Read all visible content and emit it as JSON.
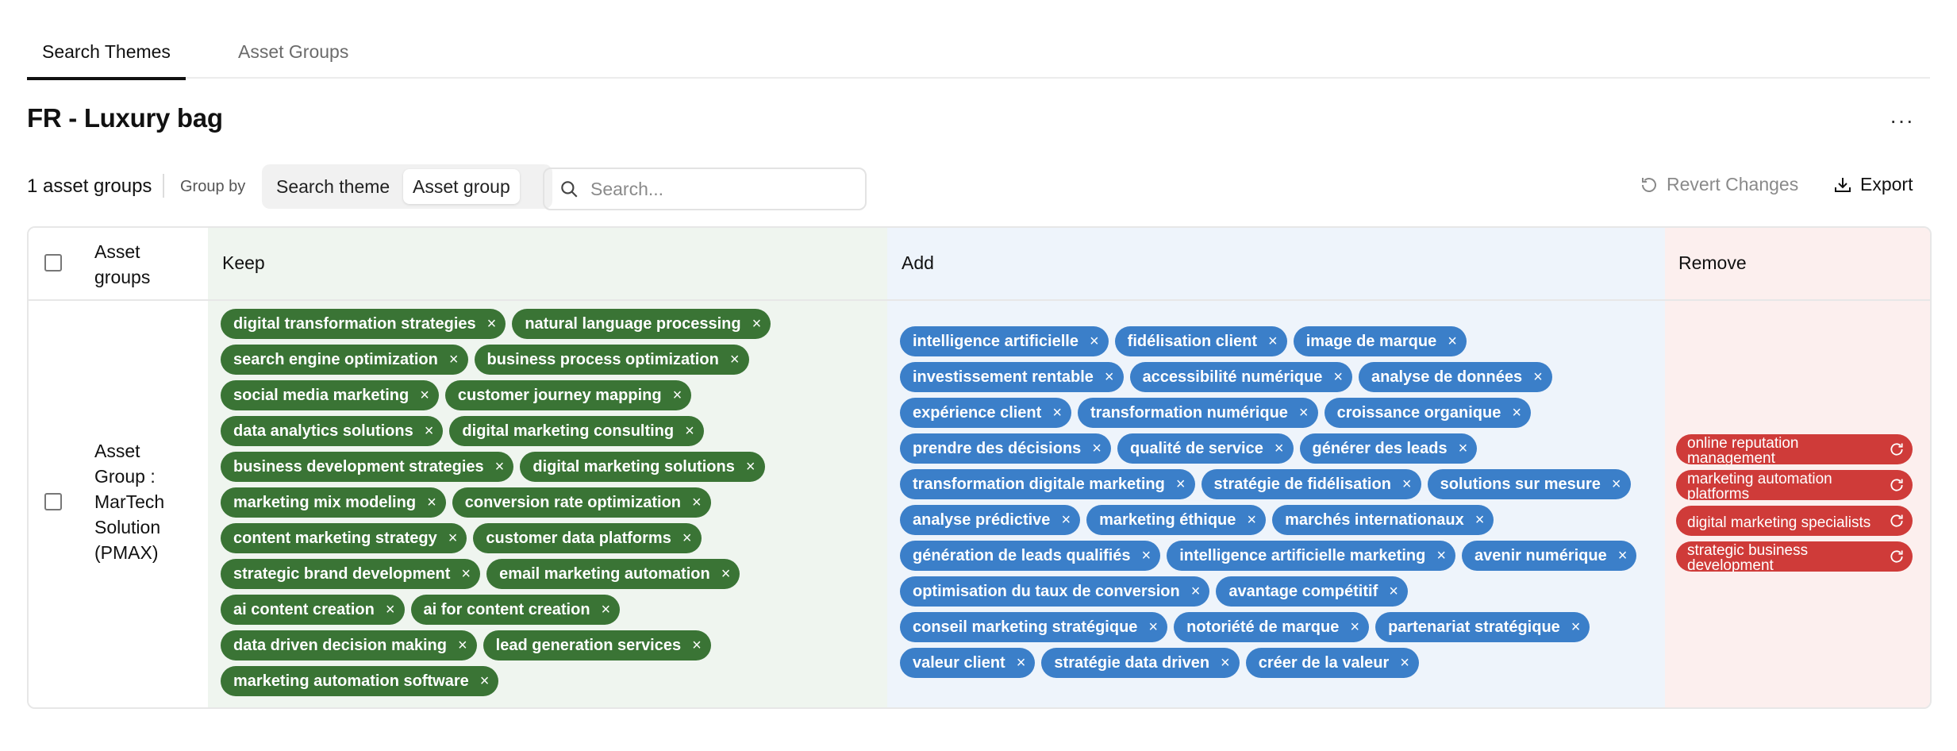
{
  "tabs": {
    "active": "Search Themes",
    "inactive": "Asset Groups"
  },
  "page": {
    "title": "FR - Luxury bag",
    "more": "···"
  },
  "toolbar": {
    "count": "1 asset groups",
    "group_by": "Group by",
    "segment": {
      "option1": "Search theme",
      "option2": "Asset group",
      "selected": "Asset group"
    },
    "search_placeholder": "Search...",
    "revert": "Revert Changes",
    "export": "Export"
  },
  "table": {
    "headers": {
      "asset_groups": "Asset groups",
      "keep": "Keep",
      "add": "Add",
      "remove": "Remove"
    },
    "row": {
      "asset_group": "Asset Group : MarTech Solution (PMAX)",
      "keep": [
        "digital transformation strategies",
        "natural language processing",
        "search engine optimization",
        "business process optimization",
        "social media marketing",
        "customer journey mapping",
        "data analytics solutions",
        "digital marketing consulting",
        "business development strategies",
        "digital marketing solutions",
        "marketing mix modeling",
        "conversion rate optimization",
        "content marketing strategy",
        "customer data platforms",
        "strategic brand development",
        "email marketing automation",
        "ai content creation",
        "ai for content creation",
        "data driven decision making",
        "lead generation services",
        "marketing automation software"
      ],
      "add": [
        "intelligence artificielle",
        "fidélisation client",
        "image de marque",
        "investissement rentable",
        "accessibilité numérique",
        "analyse de données",
        "expérience client",
        "transformation numérique",
        "croissance organique",
        "prendre des décisions",
        "qualité de service",
        "générer des leads",
        "transformation digitale marketing",
        "stratégie de fidélisation",
        "solutions sur mesure",
        "analyse prédictive",
        "marketing éthique",
        "marchés internationaux",
        "génération de leads qualifiés",
        "intelligence artificielle marketing",
        "avenir numérique",
        "optimisation du taux de conversion",
        "avantage compétitif",
        "conseil marketing stratégique",
        "notoriété de marque",
        "partenariat stratégique",
        "valeur client",
        "stratégie data driven",
        "créer de la valeur"
      ],
      "remove": [
        "online reputation management",
        "marketing automation platforms",
        "digital marketing specialists",
        "strategic business development"
      ]
    }
  },
  "icons": {
    "chip_remove": "×",
    "restore": "restore-icon"
  },
  "colors": {
    "keep": "#3a7435",
    "add": "#3b7fc9",
    "remove": "#cf3b39"
  }
}
